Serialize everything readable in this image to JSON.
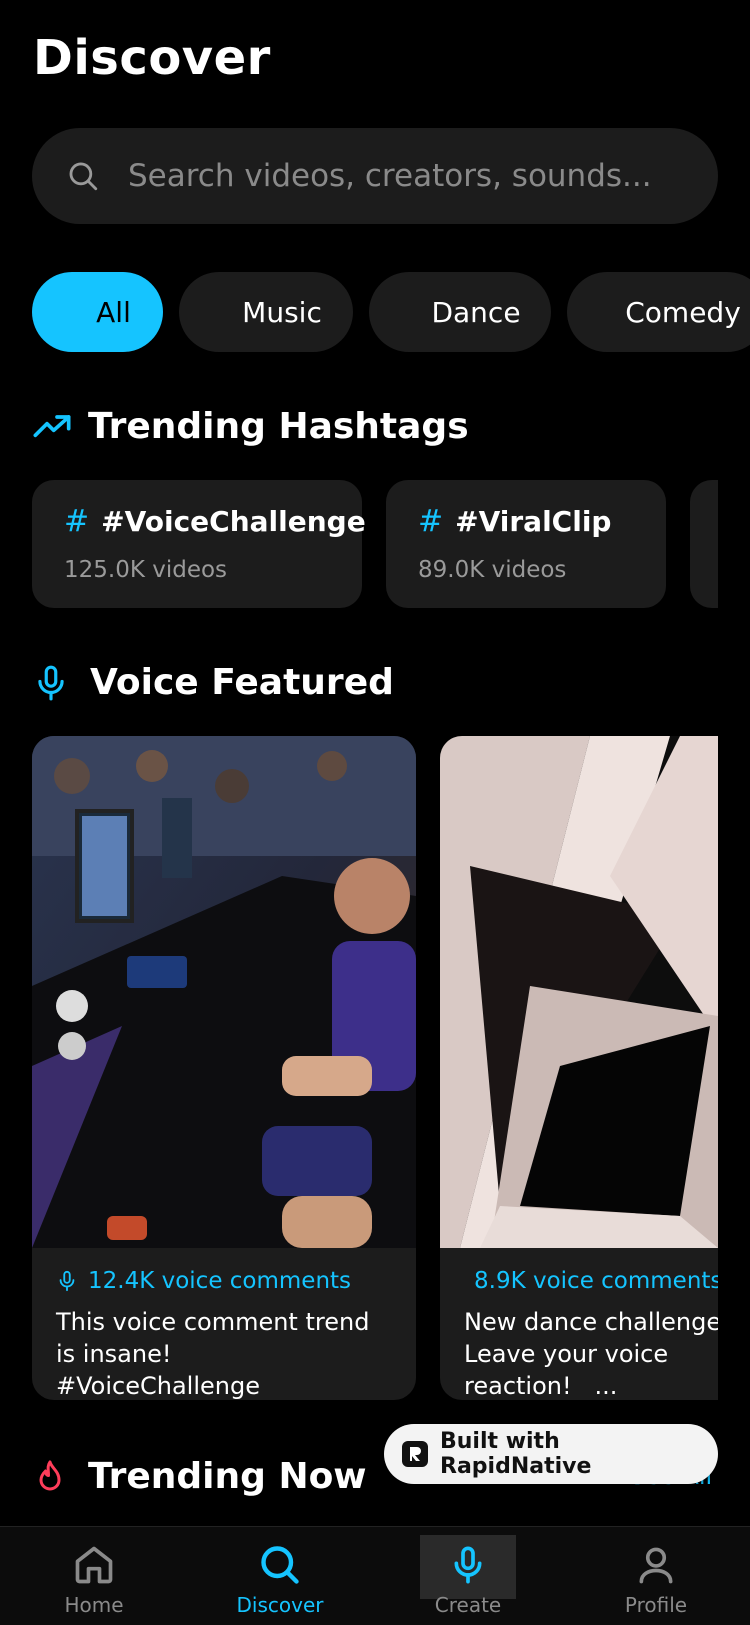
{
  "header": {
    "title": "Discover"
  },
  "search": {
    "placeholder": "Search videos, creators, sounds..."
  },
  "categories": [
    "All",
    "Music",
    "Dance",
    "Comedy"
  ],
  "trending_hashtags": {
    "title": "Trending Hashtags",
    "items": [
      {
        "tag": "#VoiceChallenge",
        "count": "125.0K videos"
      },
      {
        "tag": "#ViralClip",
        "count": "89.0K videos"
      }
    ]
  },
  "voice_featured": {
    "title": "Voice Featured",
    "items": [
      {
        "count": "12.4K voice comments",
        "caption": "This voice comment trend is insane!    #VoiceChallenge"
      },
      {
        "count": "8.9K voice comments",
        "caption": "New dance challenge! Leave your voice reaction!   ..."
      }
    ]
  },
  "trending_now": {
    "title": "Trending Now",
    "see_all": "See All"
  },
  "badge": {
    "label": "Built with RapidNative"
  },
  "nav": {
    "home": "Home",
    "discover": "Discover",
    "create": "Create",
    "profile": "Profile"
  },
  "colors": {
    "accent": "#15c4ff",
    "flame": "#ff3d5a",
    "background": "#000000",
    "card": "#1c1c1c"
  }
}
